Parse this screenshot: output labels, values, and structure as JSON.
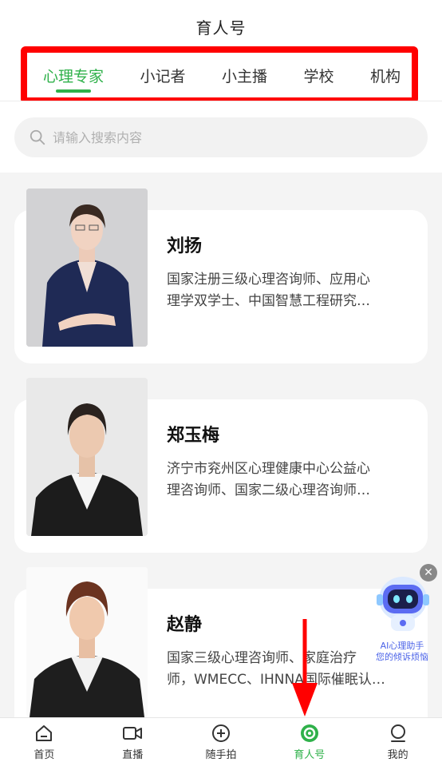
{
  "header": {
    "title": "育人号"
  },
  "tabs": [
    {
      "label": "心理专家",
      "active": true
    },
    {
      "label": "小记者"
    },
    {
      "label": "小主播"
    },
    {
      "label": "学校"
    },
    {
      "label": "机构"
    }
  ],
  "search": {
    "placeholder": "请输入搜索内容"
  },
  "experts": [
    {
      "name": "刘扬",
      "desc_line1": "国家注册三级心理咨询师、应用心",
      "desc_line2": "理学双学士、中国智慧工程研究…"
    },
    {
      "name": "郑玉梅",
      "desc_line1": "济宁市兖州区心理健康中心公益心",
      "desc_line2": "理咨询师、国家二级心理咨询师…"
    },
    {
      "name": "赵静",
      "desc_line1": "国家三级心理咨询师、家庭治疗",
      "desc_line2": "师，WMECC、IHNNA国际催眠认…"
    }
  ],
  "ai_widget": {
    "line1": "AI心理助手",
    "line2": "您的倾诉烦恼"
  },
  "bottom_nav": [
    {
      "label": "首页",
      "icon": "home-icon"
    },
    {
      "label": "直播",
      "icon": "video-camera-icon"
    },
    {
      "label": "随手拍",
      "icon": "plus-circle-icon"
    },
    {
      "label": "育人号",
      "icon": "target-icon",
      "active": true
    },
    {
      "label": "我的",
      "icon": "person-icon"
    }
  ],
  "colors": {
    "accent": "#2fb14a",
    "highlight": "#ff0000"
  }
}
